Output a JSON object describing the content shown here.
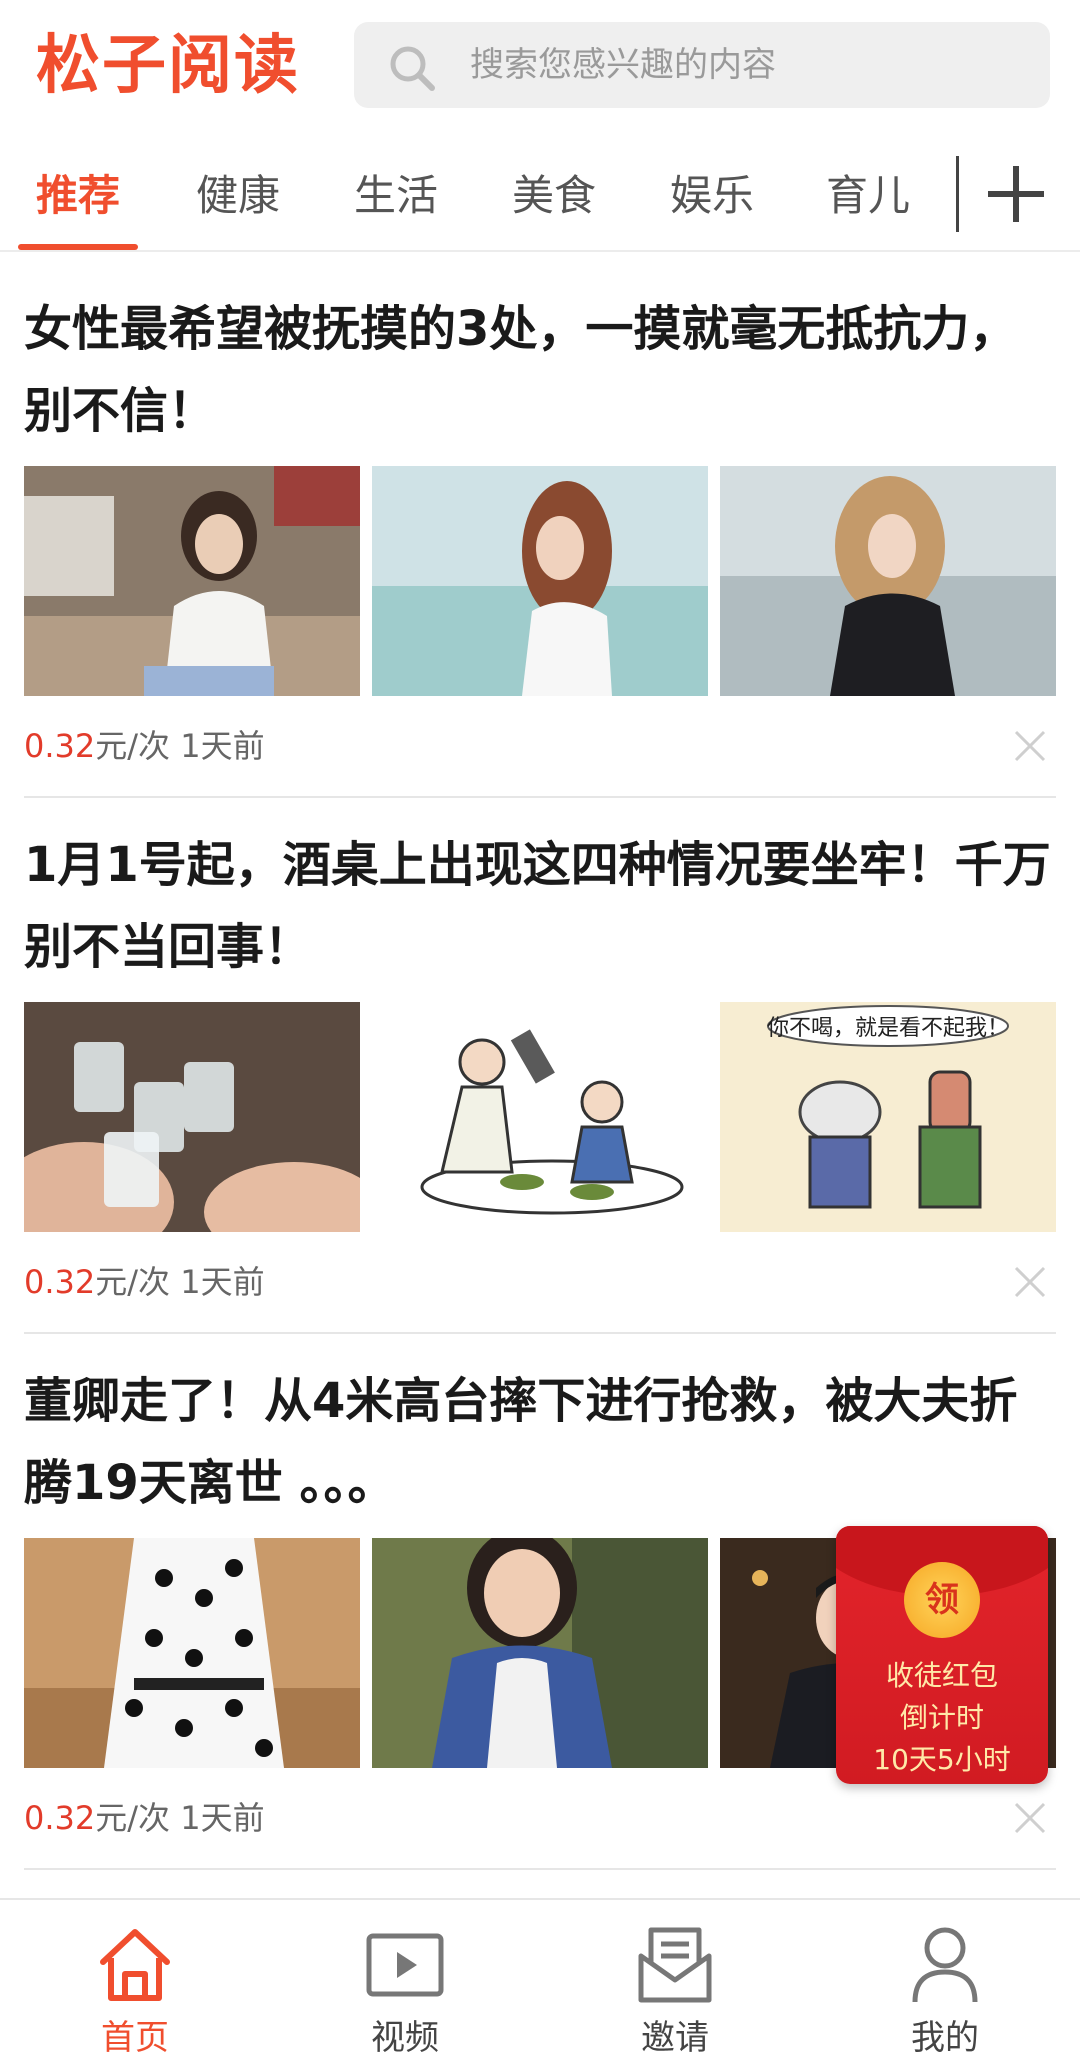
{
  "app": {
    "logo": "松子阅读"
  },
  "search": {
    "placeholder": "搜索您感兴趣的内容",
    "icon": "search-icon"
  },
  "tabs": [
    {
      "label": "推荐",
      "active": true
    },
    {
      "label": "健康",
      "active": false
    },
    {
      "label": "生活",
      "active": false
    },
    {
      "label": "美食",
      "active": false
    },
    {
      "label": "娱乐",
      "active": false
    },
    {
      "label": "育儿",
      "active": false
    }
  ],
  "add_tab_icon": "plus-icon",
  "articles": [
    {
      "title": "女性最希望被抚摸的3处，一摸就毫无抵抗力，别不信！",
      "price": "0.32",
      "price_unit": "元/次",
      "time": "1天前",
      "thumbs": [
        "woman-white-tee-photo",
        "woman-lakeside-photo",
        "woman-black-top-photo"
      ]
    },
    {
      "title": "1月1号起，酒桌上出现这四种情况要坐牢！千万别不当回事！",
      "price": "0.32",
      "price_unit": "元/次",
      "time": "1天前",
      "thumbs": [
        "liquor-toast-photo",
        "drinking-cartoon",
        "bottle-cartoon"
      ],
      "thumb_caption": "你不喝，就是看不起我！"
    },
    {
      "title": "董卿走了！从4米高台摔下进行抢救，被大夫折腾19天离世 。。。",
      "price": "0.32",
      "price_unit": "元/次",
      "time": "1天前",
      "thumbs": [
        "polka-dot-dress-photo",
        "woman-blue-vest-photo",
        "host-suit-photo"
      ]
    }
  ],
  "redpacket": {
    "coin": "领",
    "line1": "收徒红包",
    "line2": "倒计时",
    "line3": "10天5小时"
  },
  "bottom_nav": [
    {
      "label": "首页",
      "icon": "home-icon",
      "active": true
    },
    {
      "label": "视频",
      "icon": "video-icon",
      "active": false
    },
    {
      "label": "邀请",
      "icon": "invite-mail-icon",
      "active": false
    },
    {
      "label": "我的",
      "icon": "profile-icon",
      "active": false
    }
  ],
  "colors": {
    "brand": "#f04e2e",
    "price": "#e23b2a",
    "redpacket": "#d11b22",
    "coin": "#f6a623"
  }
}
